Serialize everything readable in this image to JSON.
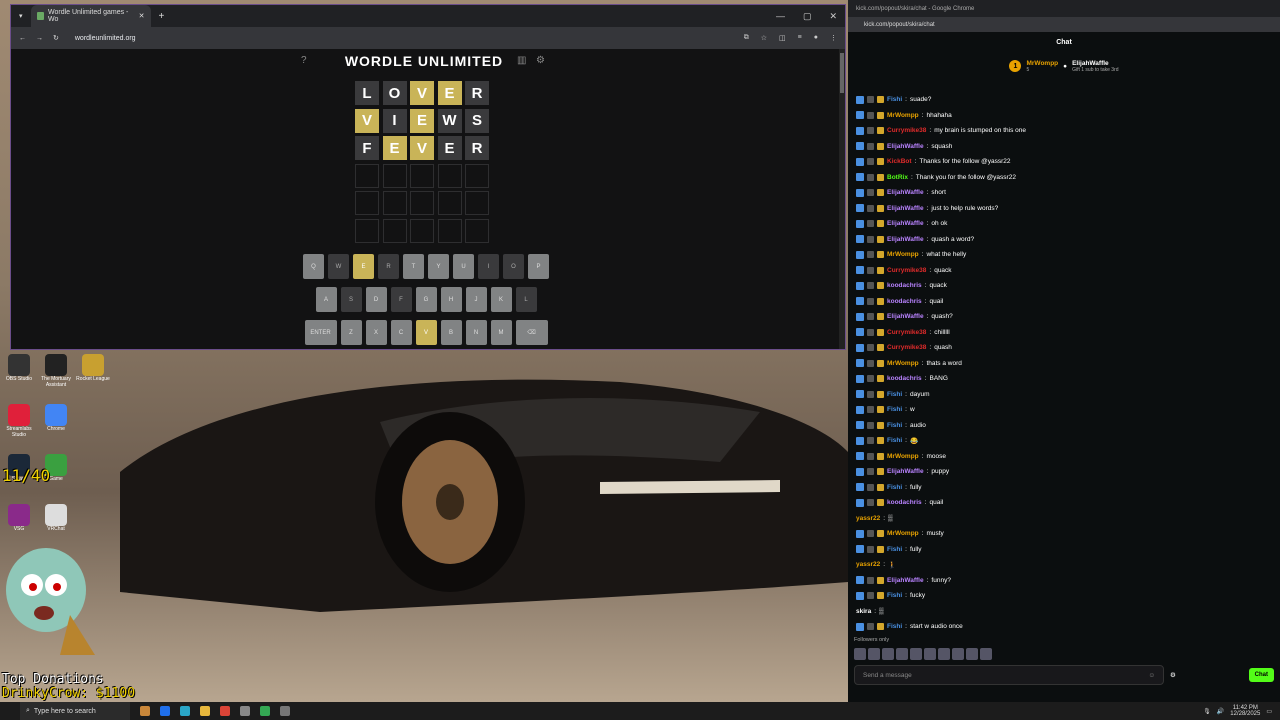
{
  "browser": {
    "tab_title": "Wordle Unlimited games - Wo",
    "url": "wordleunlimited.org"
  },
  "wordle": {
    "title": "WORDLE UNLIMITED",
    "rows": [
      [
        {
          "l": "L",
          "s": "g"
        },
        {
          "l": "O",
          "s": "g"
        },
        {
          "l": "V",
          "s": "y"
        },
        {
          "l": "E",
          "s": "y"
        },
        {
          "l": "R",
          "s": "g"
        }
      ],
      [
        {
          "l": "V",
          "s": "y"
        },
        {
          "l": "I",
          "s": "g"
        },
        {
          "l": "E",
          "s": "y"
        },
        {
          "l": "W",
          "s": "g"
        },
        {
          "l": "S",
          "s": "g"
        }
      ],
      [
        {
          "l": "F",
          "s": "g"
        },
        {
          "l": "E",
          "s": "y"
        },
        {
          "l": "V",
          "s": "y"
        },
        {
          "l": "E",
          "s": "g"
        },
        {
          "l": "R",
          "s": "g"
        }
      ],
      [
        {
          "l": "",
          "s": ""
        },
        {
          "l": "",
          "s": ""
        },
        {
          "l": "",
          "s": ""
        },
        {
          "l": "",
          "s": ""
        },
        {
          "l": "",
          "s": ""
        }
      ],
      [
        {
          "l": "",
          "s": ""
        },
        {
          "l": "",
          "s": ""
        },
        {
          "l": "",
          "s": ""
        },
        {
          "l": "",
          "s": ""
        },
        {
          "l": "",
          "s": ""
        }
      ],
      [
        {
          "l": "",
          "s": ""
        },
        {
          "l": "",
          "s": ""
        },
        {
          "l": "",
          "s": ""
        },
        {
          "l": "",
          "s": ""
        },
        {
          "l": "",
          "s": ""
        }
      ]
    ],
    "keyboard": [
      [
        {
          "k": "Q",
          "s": ""
        },
        {
          "k": "W",
          "s": "d"
        },
        {
          "k": "E",
          "s": "y"
        },
        {
          "k": "R",
          "s": "d"
        },
        {
          "k": "T",
          "s": ""
        },
        {
          "k": "Y",
          "s": ""
        },
        {
          "k": "U",
          "s": ""
        },
        {
          "k": "I",
          "s": "d"
        },
        {
          "k": "O",
          "s": "d"
        },
        {
          "k": "P",
          "s": ""
        }
      ],
      [
        {
          "k": "A",
          "s": ""
        },
        {
          "k": "S",
          "s": "d"
        },
        {
          "k": "D",
          "s": ""
        },
        {
          "k": "F",
          "s": "d"
        },
        {
          "k": "G",
          "s": ""
        },
        {
          "k": "H",
          "s": ""
        },
        {
          "k": "J",
          "s": ""
        },
        {
          "k": "K",
          "s": ""
        },
        {
          "k": "L",
          "s": "d"
        }
      ],
      [
        {
          "k": "ENTER",
          "s": "w"
        },
        {
          "k": "Z",
          "s": ""
        },
        {
          "k": "X",
          "s": ""
        },
        {
          "k": "C",
          "s": ""
        },
        {
          "k": "V",
          "s": "y"
        },
        {
          "k": "B",
          "s": ""
        },
        {
          "k": "N",
          "s": ""
        },
        {
          "k": "M",
          "s": ""
        },
        {
          "k": "⌫",
          "s": "w"
        }
      ]
    ]
  },
  "desktop": {
    "icons": [
      "OBS Studio",
      "The Mortuary Assistant",
      "Rocket League",
      "Streamlabs Studio",
      "Chrome",
      "Steam",
      "Game",
      "VSG",
      "VRChat"
    ],
    "counter": "11/40",
    "top_donations_label": "Top Donations",
    "top_donation": "DrinkyCrow: $1100"
  },
  "chat": {
    "window_title": "kick.com/popout/skira/chat - Google Chrome",
    "url": "kick.com/popout/skira/chat",
    "header": "Chat",
    "pinned_user": "MrWompp",
    "pinned_count": "5",
    "pinned_target": "ElijahWaffle",
    "pinned_text": "Gift 1 sub to take 3rd",
    "messages": [
      {
        "u": "Fishi",
        "c": "#4a90e2",
        "t": "suade?"
      },
      {
        "u": "MrWompp",
        "c": "#e8a200",
        "t": "hhahaha"
      },
      {
        "u": "Currymike38",
        "c": "#e02b2b",
        "t": "my brain is stumped on this one"
      },
      {
        "u": "ElijahWaffle",
        "c": "#b983ff",
        "t": "squash"
      },
      {
        "u": "KickBot",
        "c": "#e02b2b",
        "t": "Thanks for the follow @yassr22"
      },
      {
        "u": "BotRix",
        "c": "#53fc18",
        "t": "Thank you for the follow @yassr22"
      },
      {
        "u": "ElijahWaffle",
        "c": "#b983ff",
        "t": "short"
      },
      {
        "u": "ElijahWaffle",
        "c": "#b983ff",
        "t": "just to help rule words?"
      },
      {
        "u": "ElijahWaffle",
        "c": "#b983ff",
        "t": "oh ok"
      },
      {
        "u": "ElijahWaffle",
        "c": "#b983ff",
        "t": "quash a word?"
      },
      {
        "u": "MrWompp",
        "c": "#e8a200",
        "t": "what the helly"
      },
      {
        "u": "Currymike38",
        "c": "#e02b2b",
        "t": "quack"
      },
      {
        "u": "koodachris",
        "c": "#b983ff",
        "t": "quack"
      },
      {
        "u": "koodachris",
        "c": "#b983ff",
        "t": "quail"
      },
      {
        "u": "ElijahWaffle",
        "c": "#b983ff",
        "t": "quash?"
      },
      {
        "u": "Currymike38",
        "c": "#e02b2b",
        "t": "chilllll"
      },
      {
        "u": "Currymike38",
        "c": "#e02b2b",
        "t": "quash"
      },
      {
        "u": "MrWompp",
        "c": "#e8a200",
        "t": "thats a word"
      },
      {
        "u": "koodachris",
        "c": "#b983ff",
        "t": "BANG"
      },
      {
        "u": "Fishi",
        "c": "#4a90e2",
        "t": "dayum"
      },
      {
        "u": "Fishi",
        "c": "#4a90e2",
        "t": "w"
      },
      {
        "u": "Fishi",
        "c": "#4a90e2",
        "t": "audio"
      },
      {
        "u": "Fishi",
        "c": "#4a90e2",
        "t": "😂"
      },
      {
        "u": "MrWompp",
        "c": "#e8a200",
        "t": "moose"
      },
      {
        "u": "ElijahWaffle",
        "c": "#b983ff",
        "t": "puppy"
      },
      {
        "u": "Fishi",
        "c": "#4a90e2",
        "t": "fully"
      },
      {
        "u": "koodachris",
        "c": "#b983ff",
        "t": "quail"
      },
      {
        "u": "yassr22",
        "c": "#e8a200",
        "t": "▒"
      },
      {
        "u": "MrWompp",
        "c": "#e8a200",
        "t": "musty"
      },
      {
        "u": "Fishi",
        "c": "#4a90e2",
        "t": "fully"
      },
      {
        "u": "yassr22",
        "c": "#e8a200",
        "t": "🚶"
      },
      {
        "u": "ElijahWaffle",
        "c": "#b983ff",
        "t": "funny?"
      },
      {
        "u": "Fishi",
        "c": "#4a90e2",
        "t": "fucky"
      },
      {
        "u": "skira",
        "c": "#ffffff",
        "t": "▒"
      },
      {
        "u": "Fishi",
        "c": "#4a90e2",
        "t": "start w audio once"
      }
    ],
    "followers_only": "Followers only",
    "input_placeholder": "Send a message",
    "send_label": "Chat"
  },
  "taskbar": {
    "search_placeholder": "Type here to search",
    "time": "11:42 PM",
    "date": "12/28/2025"
  }
}
